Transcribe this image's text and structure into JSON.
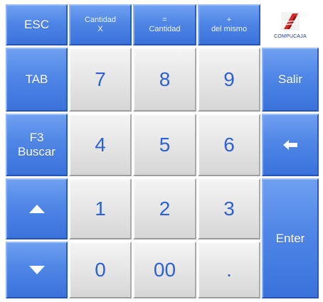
{
  "keys": {
    "esc": "ESC",
    "cantidad_x": [
      "Cantidad",
      "X"
    ],
    "igual_cantidad": [
      "=",
      "Cantidad"
    ],
    "mas_del_mismo": [
      "+",
      "del mismo"
    ],
    "tab": "TAB",
    "f3_buscar": [
      "F3",
      "Buscar"
    ],
    "salir": "Salir",
    "enter": "Enter",
    "digits": [
      "7",
      "8",
      "9",
      "4",
      "5",
      "6",
      "1",
      "2",
      "3",
      "0",
      "00",
      "."
    ]
  },
  "logo": {
    "text": "COMPUCAJA"
  },
  "icons": {
    "backspace": "arrow-left-icon",
    "up": "triangle-up-icon",
    "down": "triangle-down-icon"
  },
  "colors": {
    "blue_key": "#4f86e6",
    "gray_key": "#e4e4e4",
    "digit_text": "#2e62cf",
    "logo_red": "#d42a2a"
  }
}
